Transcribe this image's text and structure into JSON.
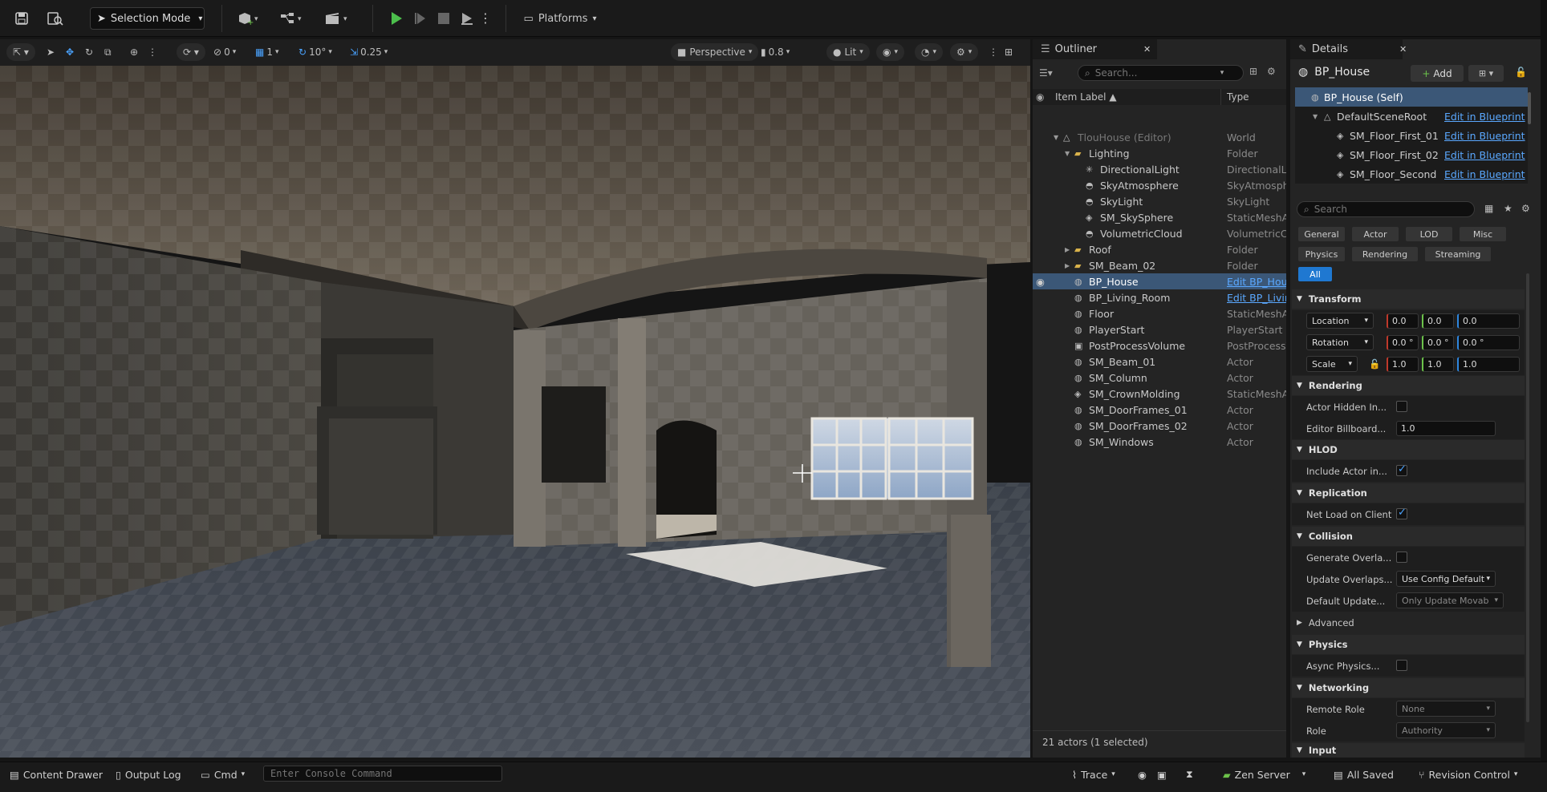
{
  "topbar": {
    "mode": "Selection Mode",
    "platforms": "Platforms"
  },
  "viewport_toolbar": {
    "rot_snap": "0",
    "grid_snap": "1",
    "angle_snap": "10°",
    "scale_snap": "0.25",
    "view": "Perspective",
    "speed": "0.8",
    "lit": "Lit"
  },
  "outliner": {
    "tab": "Outliner",
    "search_placeholder": "Search...",
    "col_label": "Item Label ▲",
    "col_type": "Type",
    "items": [
      {
        "label": "TlouHouse (Editor)",
        "type": "World"
      },
      {
        "label": "Lighting",
        "type": "Folder"
      },
      {
        "label": "DirectionalLight",
        "type": "DirectionalLig"
      },
      {
        "label": "SkyAtmosphere",
        "type": "SkyAtmosphe"
      },
      {
        "label": "SkyLight",
        "type": "SkyLight"
      },
      {
        "label": "SM_SkySphere",
        "type": "StaticMeshAc"
      },
      {
        "label": "VolumetricCloud",
        "type": "VolumetricClo"
      },
      {
        "label": "Roof",
        "type": "Folder"
      },
      {
        "label": "SM_Beam_02",
        "type": "Folder"
      },
      {
        "label": "BP_House",
        "type": "Edit BP_Hous"
      },
      {
        "label": "BP_Living_Room",
        "type": "Edit BP_Livin"
      },
      {
        "label": "Floor",
        "type": "StaticMeshAc"
      },
      {
        "label": "PlayerStart",
        "type": "PlayerStart"
      },
      {
        "label": "PostProcessVolume",
        "type": "PostProcessV"
      },
      {
        "label": "SM_Beam_01",
        "type": "Actor"
      },
      {
        "label": "SM_Column",
        "type": "Actor"
      },
      {
        "label": "SM_CrownMolding",
        "type": "StaticMeshAc"
      },
      {
        "label": "SM_DoorFrames_01",
        "type": "Actor"
      },
      {
        "label": "SM_DoorFrames_02",
        "type": "Actor"
      },
      {
        "label": "SM_Windows",
        "type": "Actor"
      }
    ],
    "status": "21 actors (1 selected)"
  },
  "details": {
    "tab": "Details",
    "actor_name": "BP_House",
    "add_label": "Add",
    "components": [
      {
        "label": "BP_House (Self)",
        "link": ""
      },
      {
        "label": "DefaultSceneRoot",
        "link": "Edit in Blueprint"
      },
      {
        "label": "SM_Floor_First_01",
        "link": "Edit in Blueprint"
      },
      {
        "label": "SM_Floor_First_02",
        "link": "Edit in Blueprint"
      },
      {
        "label": "SM_Floor_Second",
        "link": "Edit in Blueprint"
      }
    ],
    "search_placeholder": "Search",
    "filters": [
      "General",
      "Actor",
      "LOD",
      "Misc",
      "Physics",
      "Rendering",
      "Streaming",
      "All"
    ],
    "transform": {
      "title": "Transform",
      "location_label": "Location",
      "location": [
        "0.0",
        "0.0",
        "0.0"
      ],
      "rotation_label": "Rotation",
      "rotation": [
        "0.0 °",
        "0.0 °",
        "0.0 °"
      ],
      "scale_label": "Scale",
      "scale": [
        "1.0",
        "1.0",
        "1.0"
      ]
    },
    "rendering": {
      "title": "Rendering",
      "hidden_label": "Actor Hidden In...",
      "billboard_label": "Editor Billboard...",
      "billboard_value": "1.0"
    },
    "hlod": {
      "title": "HLOD",
      "include_label": "Include Actor in..."
    },
    "replication": {
      "title": "Replication",
      "net_load_label": "Net Load on Client"
    },
    "collision": {
      "title": "Collision",
      "gen_overlap_label": "Generate Overla...",
      "update_overlaps_label": "Update Overlaps...",
      "update_overlaps_value": "Use Config Default",
      "default_update_label": "Default Update...",
      "default_update_value": "Only Update Movab",
      "advanced": "Advanced"
    },
    "physics": {
      "title": "Physics",
      "async_label": "Async Physics..."
    },
    "networking": {
      "title": "Networking",
      "remote_role_label": "Remote Role",
      "remote_role_value": "None",
      "role_label": "Role",
      "role_value": "Authority",
      "input_title": "Input"
    }
  },
  "bottombar": {
    "content_drawer": "Content Drawer",
    "output_log": "Output Log",
    "cmd": "Cmd",
    "console_placeholder": "Enter Console Command",
    "trace": "Trace",
    "zen": "Zen Server",
    "saved": "All Saved",
    "revision": "Revision Control"
  }
}
